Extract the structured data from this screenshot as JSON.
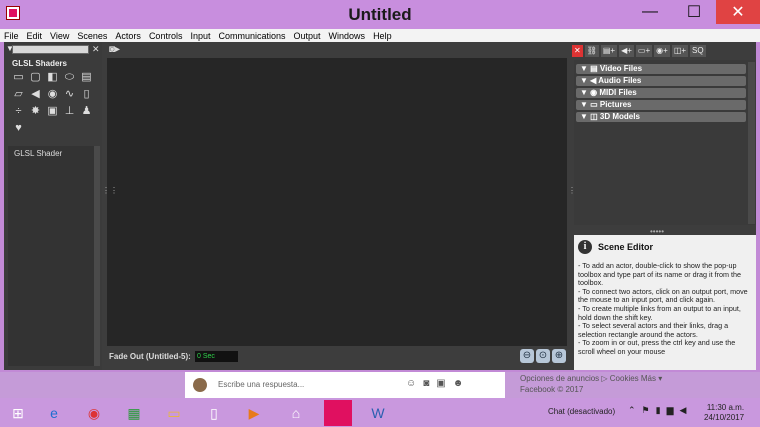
{
  "window": {
    "title": "Untitled",
    "minimize": "—",
    "maximize": "☐",
    "close": "✕"
  },
  "menu": [
    "File",
    "Edit",
    "View",
    "Scenes",
    "Actors",
    "Controls",
    "Input",
    "Communications",
    "Output",
    "Windows",
    "Help"
  ],
  "toolbox": {
    "search_value": "",
    "title": "GLSL Shaders",
    "list_item": "GLSL Shader"
  },
  "status": {
    "label": "Fade Out (Untitled-5):",
    "value": "0 Sec"
  },
  "media_panel": {
    "rows": [
      "Video Files",
      "Audio Files",
      "MIDI Files",
      "Pictures",
      "3D Models"
    ]
  },
  "scene_editor": {
    "title": "Scene Editor",
    "lines": [
      "- To add an actor, double-click to show the pop-up toolbox and type part of its name or drag it from the toolbox.",
      "- To connect two actors, click on an output port, move the mouse to an input port, and click again.",
      "- To create multiple links from an output to an input, hold down the shift key.",
      "- To select several actors and their links, drag a selection rectangle around the actors.",
      "- To zoom in or out, press the ctrl key and use the scroll wheel on your mouse"
    ]
  },
  "facebook": {
    "placeholder": "Escribe una respuesta...",
    "links_line1": "Opciones de anuncios ▷  Cookies  Más ▾",
    "links_line2": "Facebook © 2017"
  },
  "taskbar": {
    "chat": "Chat (desactivado)",
    "time": "11:30 a.m.",
    "date": "24/10/2017"
  },
  "colors": {
    "titlebar": "#c88ede",
    "close": "#e04343",
    "status_value": "#2fd14a"
  }
}
